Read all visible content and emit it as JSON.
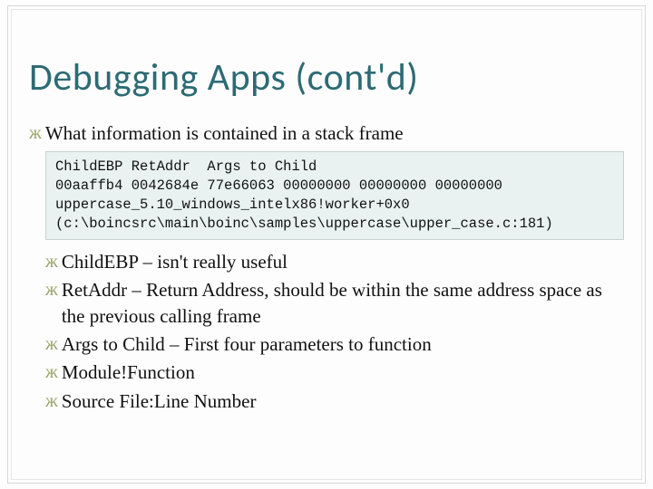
{
  "title": "Debugging Apps (cont'd)",
  "lead_bullet": "What information is contained in a stack frame",
  "code": {
    "l1": "ChildEBP RetAddr  Args to Child",
    "l2": "00aaffb4 0042684e 77e66063 00000000 00000000 00000000",
    "l3": "uppercase_5.10_windows_intelx86!worker+0x0",
    "l4": "(c:\\boincsrc\\main\\boinc\\samples\\uppercase\\upper_case.c:181)"
  },
  "bullets": [
    "ChildEBP – isn't really useful",
    "RetAddr – Return Address, should be within the same address space as the previous calling frame",
    "Args to Child – First four parameters to function",
    "Module!Function",
    "Source File:Line Number"
  ]
}
